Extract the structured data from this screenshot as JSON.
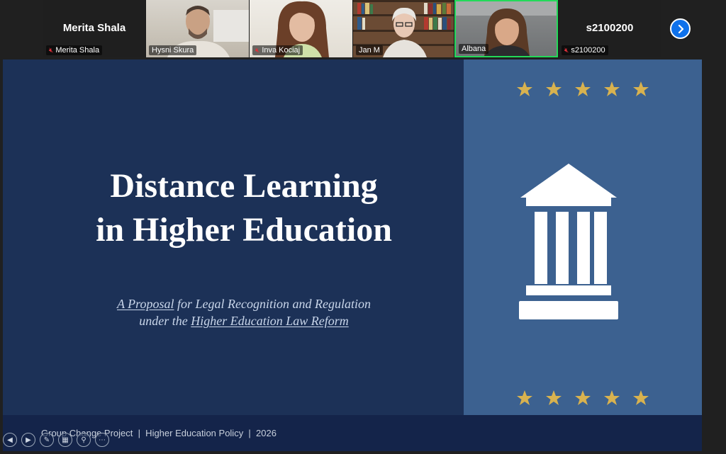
{
  "participants": [
    {
      "display": "Merita Shala",
      "label": "Merita Shala",
      "muted": true,
      "video": false
    },
    {
      "label": "Hysni Skura",
      "muted": false,
      "video": true
    },
    {
      "label": "Inva Kociaj",
      "muted": true,
      "video": true
    },
    {
      "label": "Jan M",
      "muted": false,
      "video": true
    },
    {
      "label": "Albana",
      "muted": false,
      "video": true,
      "active": true
    },
    {
      "display": "s2100200",
      "label": "s2100200",
      "muted": true,
      "video": false
    }
  ],
  "slide": {
    "title_line1": "Distance Learning",
    "title_line2": "in Higher Education",
    "subtitle_part1": "A Proposal",
    "subtitle_part2": " for Legal Recognition and Regulation",
    "subtitle_part3": "under the ",
    "subtitle_part4": "Higher Education Law Reform",
    "footer": "Group Change Project  |  Higher Education Policy  |  2026",
    "star_count_top": 5,
    "star_count_bottom": 5,
    "icon": "institution-building-icon"
  },
  "colors": {
    "slide_bg": "#1c3157",
    "panel_bg": "#3c6190",
    "footer_bg": "#14244a",
    "star": "#d8b24f",
    "active_border": "#23d959",
    "next_button": "#0e71eb"
  },
  "slide_controls": [
    "previous-slide-icon",
    "next-slide-icon",
    "pen-icon",
    "slides-grid-icon",
    "zoom-icon",
    "more-icon"
  ]
}
